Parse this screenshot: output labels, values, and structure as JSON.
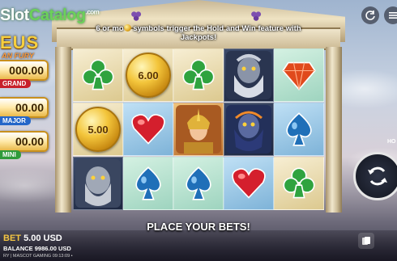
{
  "branding": {
    "watermark_slot": "Slot",
    "watermark_catalog": "Catalog",
    "watermark_tld": ".com",
    "game_title": "EUS",
    "game_subtitle": "AN FURY"
  },
  "banner": {
    "line1_pre": "6 or mo",
    "line1_post": " symbols trigger the Hold and Win feature with",
    "line2": "Jackpots!"
  },
  "jackpots": [
    {
      "value": "000.00",
      "label": "GRAND",
      "color": "#c8202a"
    },
    {
      "value": "00.00",
      "label": "MAJOR",
      "color": "#2466c8"
    },
    {
      "value": "00.00",
      "label": "MINI",
      "color": "#2f9b3a"
    }
  ],
  "reels": [
    {
      "row": 0,
      "col": 0,
      "symbol": "club-icon",
      "bg": "gold"
    },
    {
      "row": 0,
      "col": 1,
      "symbol": "coin",
      "value": "6.00",
      "bg": "gold"
    },
    {
      "row": 0,
      "col": 2,
      "symbol": "club-icon",
      "bg": "gold"
    },
    {
      "row": 0,
      "col": 3,
      "symbol": "zeus-portrait",
      "bg": "dark"
    },
    {
      "row": 0,
      "col": 4,
      "symbol": "diamond-icon",
      "bg": "mint"
    },
    {
      "row": 1,
      "col": 0,
      "symbol": "coin",
      "value": "5.00",
      "bg": "gold"
    },
    {
      "row": 1,
      "col": 1,
      "symbol": "heart-icon",
      "bg": "blue"
    },
    {
      "row": 1,
      "col": 2,
      "symbol": "hero-portrait",
      "bg": "orange"
    },
    {
      "row": 1,
      "col": 3,
      "symbol": "titan-portrait",
      "bg": "dark"
    },
    {
      "row": 1,
      "col": 4,
      "symbol": "spade-icon",
      "bg": "blue"
    },
    {
      "row": 2,
      "col": 0,
      "symbol": "stone-giant-portrait",
      "bg": "dark"
    },
    {
      "row": 2,
      "col": 1,
      "symbol": "spade-icon",
      "bg": "mint"
    },
    {
      "row": 2,
      "col": 2,
      "symbol": "spade-icon",
      "bg": "mint"
    },
    {
      "row": 2,
      "col": 3,
      "symbol": "heart-icon",
      "bg": "blue"
    },
    {
      "row": 2,
      "col": 4,
      "symbol": "club-icon",
      "bg": "gold"
    }
  ],
  "status": {
    "caption": "PLACE YOUR BETS!",
    "bet_label": "BET",
    "bet_value": "5.00 USD",
    "balance_label": "BALANCE",
    "balance_value": "9986.00 USD",
    "footer": "RY | MASCOT GAMING  09:13:09 •",
    "auto_label": "HO"
  },
  "colors": {
    "gold": "#f3c53b",
    "club": "#2fa33f",
    "heart": "#d41f2d",
    "spade": "#1f6fb8",
    "diamond": "#e04a1c"
  }
}
